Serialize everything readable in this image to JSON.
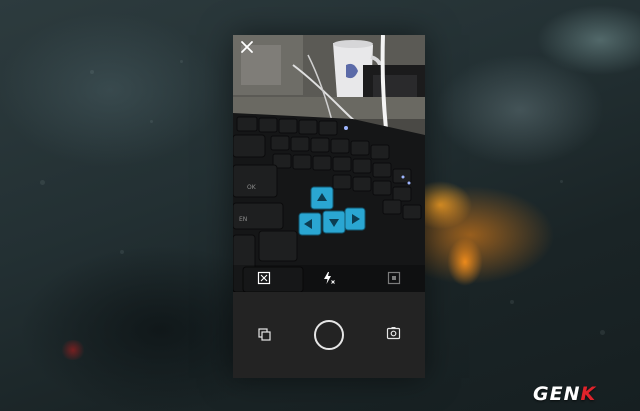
{
  "screen": {
    "close_icon": "close-icon",
    "overlay_icons": [
      "grid-icon",
      "flash-auto-icon",
      "timer-icon"
    ],
    "controls": [
      "gallery-icon",
      "shutter-button",
      "switch-camera-icon"
    ]
  },
  "colors": {
    "key_cap": "#1e1f20",
    "key_blue": "#2aa6d2",
    "panel": "#232323",
    "accent_logo": "#e0232b"
  },
  "watermark": {
    "prefix": "GEN",
    "accent": "K"
  }
}
